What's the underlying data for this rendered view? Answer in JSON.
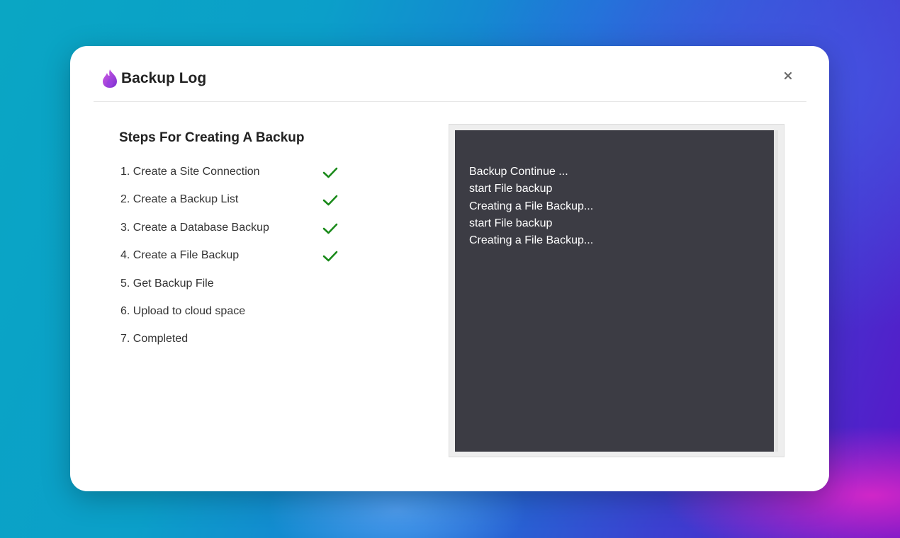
{
  "dialog": {
    "title": "Backup Log",
    "logo_icon": "flame-drop-logo-icon",
    "close_icon": "close-icon",
    "close_label": "×"
  },
  "steps": {
    "heading": "Steps For Creating A Backup",
    "items": [
      {
        "label": "1. Create a Site Connection",
        "completed": true
      },
      {
        "label": "2. Create a Backup List",
        "completed": true
      },
      {
        "label": "3. Create a Database Backup",
        "completed": true
      },
      {
        "label": "4. Create a File Backup",
        "completed": true
      },
      {
        "label": "5. Get Backup File",
        "completed": false
      },
      {
        "label": "6. Upload to cloud space",
        "completed": false
      },
      {
        "label": "7. Completed",
        "completed": false
      }
    ]
  },
  "console": {
    "lines": [
      "Backup Continue ...",
      "start File backup",
      "Creating a File Backup...",
      "start File backup",
      "Creating a File Backup..."
    ]
  },
  "colors": {
    "check": "#1a8a1a",
    "console_bg": "#3c3c44",
    "logo_start": "#c04fd8",
    "logo_end": "#7a2fd0"
  }
}
